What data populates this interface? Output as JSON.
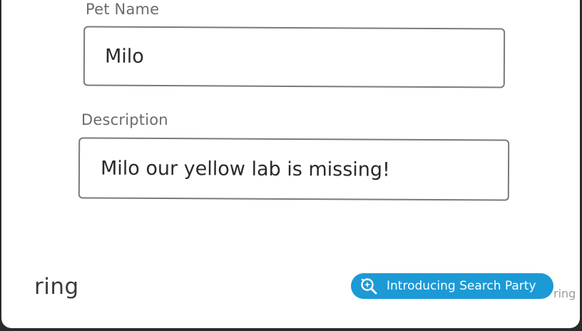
{
  "form": {
    "pet_name_label": "Pet Name",
    "pet_name_value": "Milo",
    "description_label": "Description",
    "description_value": "Milo our yellow lab is missing!"
  },
  "branding": {
    "logo_text": "ring",
    "promo_text": "Introducing Search Party",
    "small_logo_text": "ring"
  },
  "colors": {
    "accent": "#1c9ad6",
    "label_gray": "#6b6b6b",
    "border": "#7a7a7a"
  },
  "icons": {
    "promo_icon": "magnifier-sparkle-icon"
  }
}
